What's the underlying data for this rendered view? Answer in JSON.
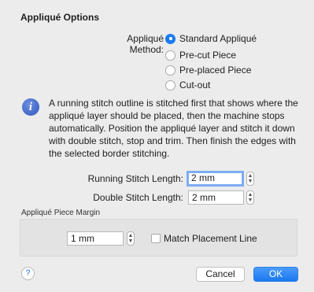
{
  "dialog": {
    "title": "Appliqué Options",
    "method_label": "Appliqué Method:",
    "methods": [
      {
        "label": "Standard Appliqué",
        "selected": true
      },
      {
        "label": "Pre-cut Piece",
        "selected": false
      },
      {
        "label": "Pre-placed Piece",
        "selected": false
      },
      {
        "label": "Cut-out",
        "selected": false
      }
    ],
    "info_icon": "info-icon",
    "info_text": "A running stitch outline is stitched first that shows where the appliqué layer should be placed, then the machine stops automatically. Position the appliqué layer and stitch it down with double stitch, stop and trim. Then finish the edges with the selected border stitching.",
    "running_stitch_label": "Running Stitch Length:",
    "running_stitch_value": "2 mm",
    "double_stitch_label": "Double Stitch Length:",
    "double_stitch_value": "2 mm",
    "margin_section_label": "Appliqué Piece Margin",
    "margin_value": "1 mm",
    "match_placement_label": "Match Placement Line",
    "match_placement_checked": false,
    "help_label": "?",
    "cancel_label": "Cancel",
    "ok_label": "OK",
    "accent_color": "#1a7bf2"
  }
}
